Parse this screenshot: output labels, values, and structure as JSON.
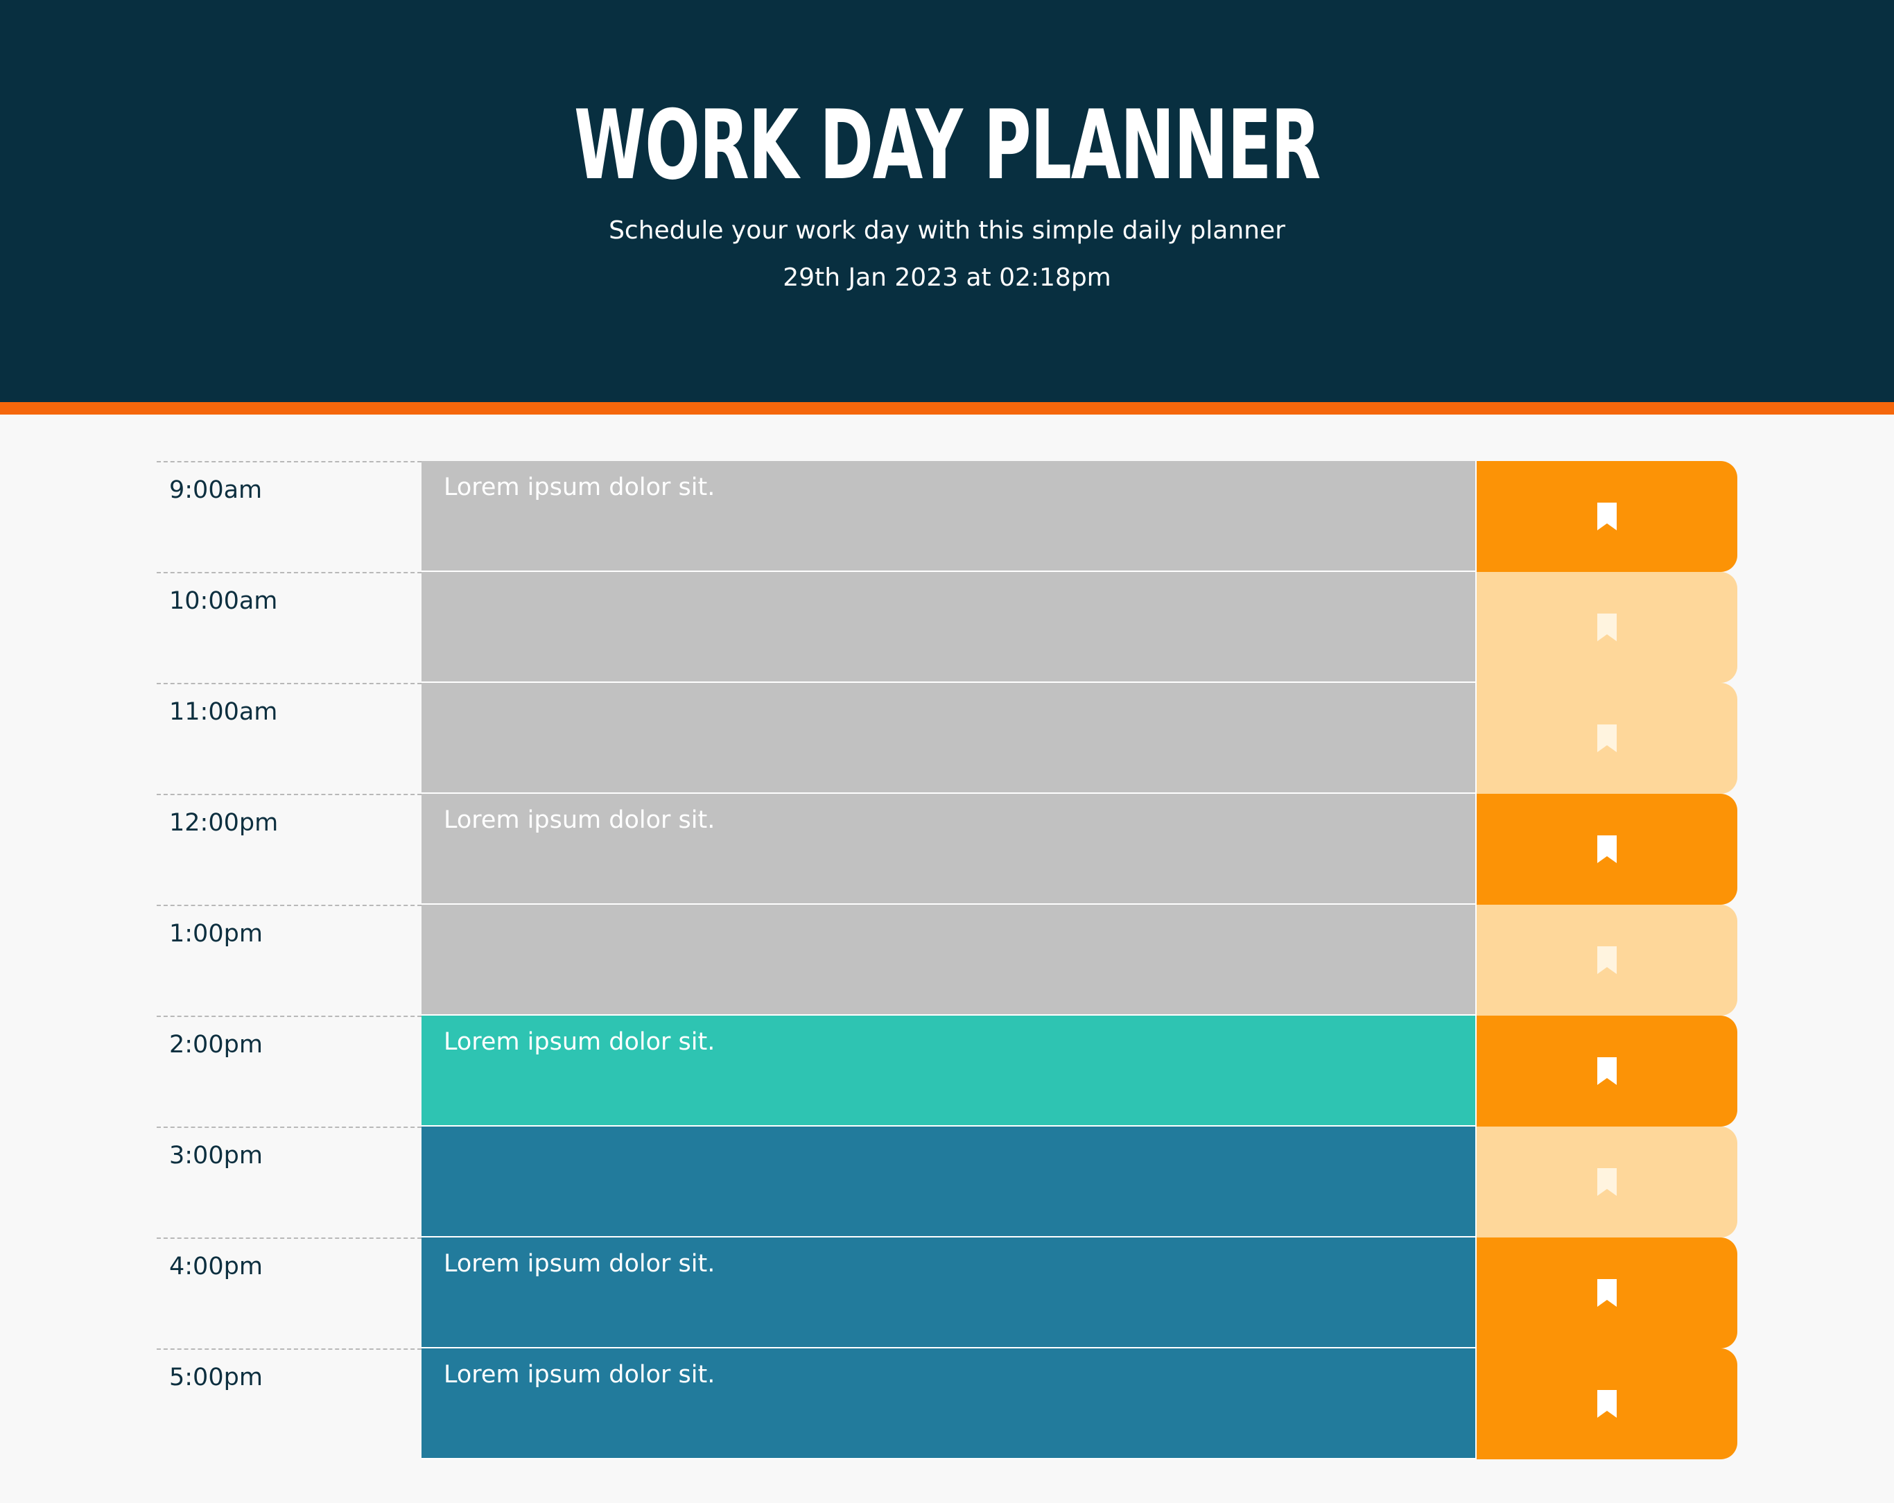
{
  "header": {
    "title": "WORK DAY PLANNER",
    "subtitle": "Schedule your work day with this simple daily planner",
    "datetime": "29th Jan 2023 at 02:18pm"
  },
  "colors": {
    "header_bg": "#082f40",
    "header_border": "#f5670c",
    "past": "#c1c1c1",
    "present": "#2ec4b2",
    "future": "#227b9c",
    "saved_button": "#fc9306",
    "empty_button": "#fed79a"
  },
  "rows": [
    {
      "time": "9:00am",
      "text": "Lorem ipsum dolor sit.",
      "status": "past",
      "saved": true,
      "icon": "bookmark-icon"
    },
    {
      "time": "10:00am",
      "text": "",
      "status": "past",
      "saved": false,
      "icon": "bookmark-icon"
    },
    {
      "time": "11:00am",
      "text": "",
      "status": "past",
      "saved": false,
      "icon": "bookmark-icon"
    },
    {
      "time": "12:00pm",
      "text": "Lorem ipsum dolor sit.",
      "status": "past",
      "saved": true,
      "icon": "bookmark-icon"
    },
    {
      "time": "1:00pm",
      "text": "",
      "status": "past",
      "saved": false,
      "icon": "bookmark-icon"
    },
    {
      "time": "2:00pm",
      "text": "Lorem ipsum dolor sit.",
      "status": "present",
      "saved": true,
      "icon": "bookmark-icon"
    },
    {
      "time": "3:00pm",
      "text": "",
      "status": "future",
      "saved": false,
      "icon": "bookmark-icon"
    },
    {
      "time": "4:00pm",
      "text": "Lorem ipsum dolor sit.",
      "status": "future",
      "saved": true,
      "icon": "bookmark-icon"
    },
    {
      "time": "5:00pm",
      "text": "Lorem ipsum dolor sit.",
      "status": "future",
      "saved": true,
      "icon": "bookmark-icon"
    }
  ]
}
